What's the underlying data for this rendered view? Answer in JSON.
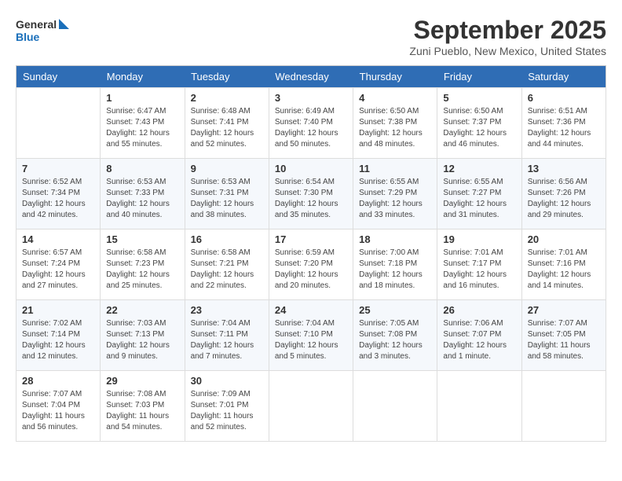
{
  "header": {
    "logo_line1": "General",
    "logo_line2": "Blue",
    "month_title": "September 2025",
    "location": "Zuni Pueblo, New Mexico, United States"
  },
  "weekdays": [
    "Sunday",
    "Monday",
    "Tuesday",
    "Wednesday",
    "Thursday",
    "Friday",
    "Saturday"
  ],
  "weeks": [
    [
      {
        "day": "",
        "info": ""
      },
      {
        "day": "1",
        "info": "Sunrise: 6:47 AM\nSunset: 7:43 PM\nDaylight: 12 hours\nand 55 minutes."
      },
      {
        "day": "2",
        "info": "Sunrise: 6:48 AM\nSunset: 7:41 PM\nDaylight: 12 hours\nand 52 minutes."
      },
      {
        "day": "3",
        "info": "Sunrise: 6:49 AM\nSunset: 7:40 PM\nDaylight: 12 hours\nand 50 minutes."
      },
      {
        "day": "4",
        "info": "Sunrise: 6:50 AM\nSunset: 7:38 PM\nDaylight: 12 hours\nand 48 minutes."
      },
      {
        "day": "5",
        "info": "Sunrise: 6:50 AM\nSunset: 7:37 PM\nDaylight: 12 hours\nand 46 minutes."
      },
      {
        "day": "6",
        "info": "Sunrise: 6:51 AM\nSunset: 7:36 PM\nDaylight: 12 hours\nand 44 minutes."
      }
    ],
    [
      {
        "day": "7",
        "info": "Sunrise: 6:52 AM\nSunset: 7:34 PM\nDaylight: 12 hours\nand 42 minutes."
      },
      {
        "day": "8",
        "info": "Sunrise: 6:53 AM\nSunset: 7:33 PM\nDaylight: 12 hours\nand 40 minutes."
      },
      {
        "day": "9",
        "info": "Sunrise: 6:53 AM\nSunset: 7:31 PM\nDaylight: 12 hours\nand 38 minutes."
      },
      {
        "day": "10",
        "info": "Sunrise: 6:54 AM\nSunset: 7:30 PM\nDaylight: 12 hours\nand 35 minutes."
      },
      {
        "day": "11",
        "info": "Sunrise: 6:55 AM\nSunset: 7:29 PM\nDaylight: 12 hours\nand 33 minutes."
      },
      {
        "day": "12",
        "info": "Sunrise: 6:55 AM\nSunset: 7:27 PM\nDaylight: 12 hours\nand 31 minutes."
      },
      {
        "day": "13",
        "info": "Sunrise: 6:56 AM\nSunset: 7:26 PM\nDaylight: 12 hours\nand 29 minutes."
      }
    ],
    [
      {
        "day": "14",
        "info": "Sunrise: 6:57 AM\nSunset: 7:24 PM\nDaylight: 12 hours\nand 27 minutes."
      },
      {
        "day": "15",
        "info": "Sunrise: 6:58 AM\nSunset: 7:23 PM\nDaylight: 12 hours\nand 25 minutes."
      },
      {
        "day": "16",
        "info": "Sunrise: 6:58 AM\nSunset: 7:21 PM\nDaylight: 12 hours\nand 22 minutes."
      },
      {
        "day": "17",
        "info": "Sunrise: 6:59 AM\nSunset: 7:20 PM\nDaylight: 12 hours\nand 20 minutes."
      },
      {
        "day": "18",
        "info": "Sunrise: 7:00 AM\nSunset: 7:18 PM\nDaylight: 12 hours\nand 18 minutes."
      },
      {
        "day": "19",
        "info": "Sunrise: 7:01 AM\nSunset: 7:17 PM\nDaylight: 12 hours\nand 16 minutes."
      },
      {
        "day": "20",
        "info": "Sunrise: 7:01 AM\nSunset: 7:16 PM\nDaylight: 12 hours\nand 14 minutes."
      }
    ],
    [
      {
        "day": "21",
        "info": "Sunrise: 7:02 AM\nSunset: 7:14 PM\nDaylight: 12 hours\nand 12 minutes."
      },
      {
        "day": "22",
        "info": "Sunrise: 7:03 AM\nSunset: 7:13 PM\nDaylight: 12 hours\nand 9 minutes."
      },
      {
        "day": "23",
        "info": "Sunrise: 7:04 AM\nSunset: 7:11 PM\nDaylight: 12 hours\nand 7 minutes."
      },
      {
        "day": "24",
        "info": "Sunrise: 7:04 AM\nSunset: 7:10 PM\nDaylight: 12 hours\nand 5 minutes."
      },
      {
        "day": "25",
        "info": "Sunrise: 7:05 AM\nSunset: 7:08 PM\nDaylight: 12 hours\nand 3 minutes."
      },
      {
        "day": "26",
        "info": "Sunrise: 7:06 AM\nSunset: 7:07 PM\nDaylight: 12 hours\nand 1 minute."
      },
      {
        "day": "27",
        "info": "Sunrise: 7:07 AM\nSunset: 7:05 PM\nDaylight: 11 hours\nand 58 minutes."
      }
    ],
    [
      {
        "day": "28",
        "info": "Sunrise: 7:07 AM\nSunset: 7:04 PM\nDaylight: 11 hours\nand 56 minutes."
      },
      {
        "day": "29",
        "info": "Sunrise: 7:08 AM\nSunset: 7:03 PM\nDaylight: 11 hours\nand 54 minutes."
      },
      {
        "day": "30",
        "info": "Sunrise: 7:09 AM\nSunset: 7:01 PM\nDaylight: 11 hours\nand 52 minutes."
      },
      {
        "day": "",
        "info": ""
      },
      {
        "day": "",
        "info": ""
      },
      {
        "day": "",
        "info": ""
      },
      {
        "day": "",
        "info": ""
      }
    ]
  ]
}
